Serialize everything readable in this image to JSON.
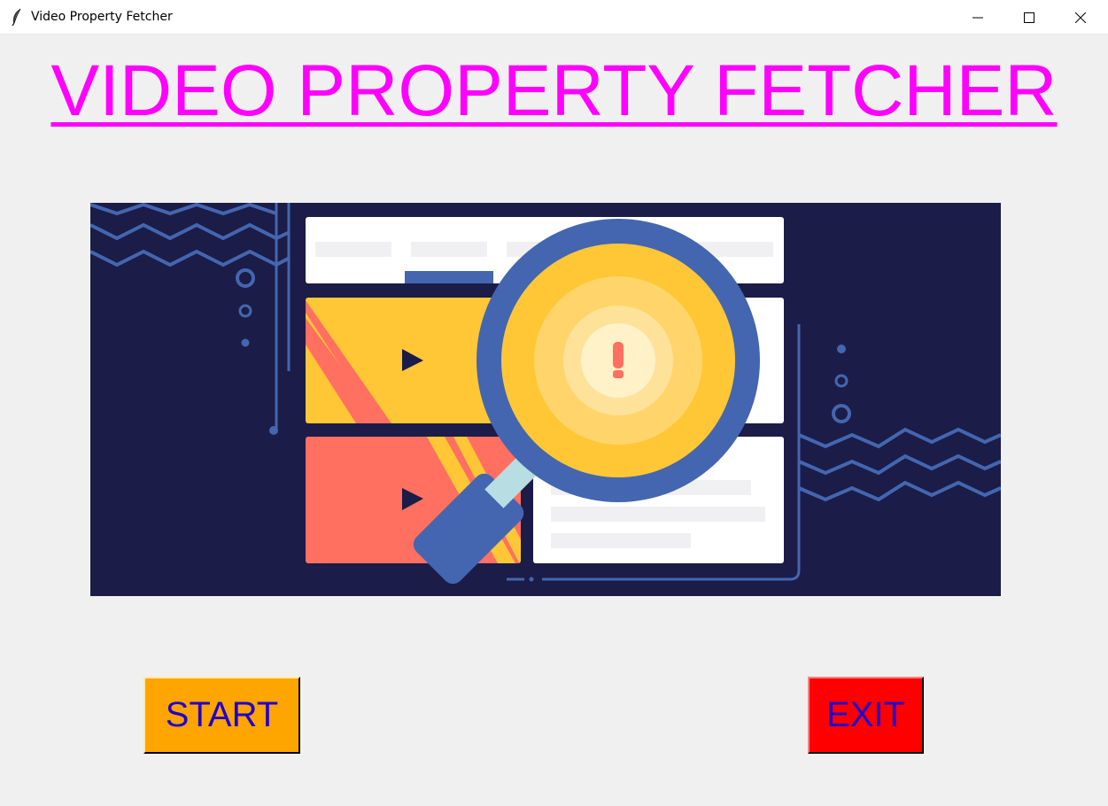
{
  "window": {
    "title": "Video Property Fetcher",
    "app_icon": "feather-icon",
    "controls": [
      "minimize-icon",
      "maximize-icon",
      "close-icon"
    ]
  },
  "heading": {
    "text": "VIDEO PROPERTY FETCHER",
    "color": "#ff00ff"
  },
  "banner": {
    "description_icon": "video-search-illustration",
    "colors": {
      "background": "#1b1c48",
      "accent_blue": "#4466b0",
      "yellow": "#ffc736",
      "coral": "#ff7060",
      "white": "#ffffff"
    }
  },
  "buttons": {
    "start_label": "START",
    "start_color": "#ffa500",
    "exit_label": "EXIT",
    "exit_color": "#ff0000",
    "text_color": "#2200cc"
  }
}
